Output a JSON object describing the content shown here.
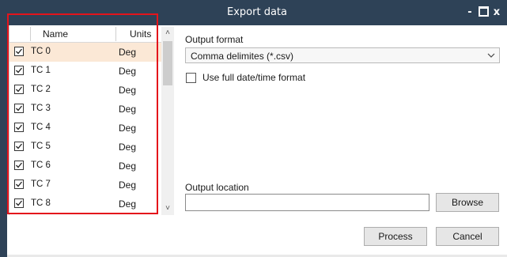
{
  "window": {
    "title": "Export data",
    "controls": {
      "minimize": "-",
      "close": "x"
    }
  },
  "list": {
    "columns": {
      "name": "Name",
      "units": "Units"
    },
    "rows": [
      {
        "name": "TC 0",
        "units": "Deg",
        "checked": true,
        "selected": true
      },
      {
        "name": "TC 1",
        "units": "Deg",
        "checked": true,
        "selected": false
      },
      {
        "name": "TC 2",
        "units": "Deg",
        "checked": true,
        "selected": false
      },
      {
        "name": "TC 3",
        "units": "Deg",
        "checked": true,
        "selected": false
      },
      {
        "name": "TC 4",
        "units": "Deg",
        "checked": true,
        "selected": false
      },
      {
        "name": "TC 5",
        "units": "Deg",
        "checked": true,
        "selected": false
      },
      {
        "name": "TC 6",
        "units": "Deg",
        "checked": true,
        "selected": false
      },
      {
        "name": "TC 7",
        "units": "Deg",
        "checked": true,
        "selected": false
      },
      {
        "name": "TC 8",
        "units": "Deg",
        "checked": true,
        "selected": false
      }
    ]
  },
  "form": {
    "output_format_label": "Output format",
    "output_format_value": "Comma delimites (*.csv)",
    "full_datetime_label": "Use full date/time format",
    "full_datetime_checked": false,
    "output_location_label": "Output location",
    "output_location_value": "",
    "browse_label": "Browse",
    "process_label": "Process",
    "cancel_label": "Cancel"
  },
  "colors": {
    "titlebar": "#2e4257",
    "selected_row": "#fbe8d6",
    "highlight_box": "#e4141b"
  }
}
